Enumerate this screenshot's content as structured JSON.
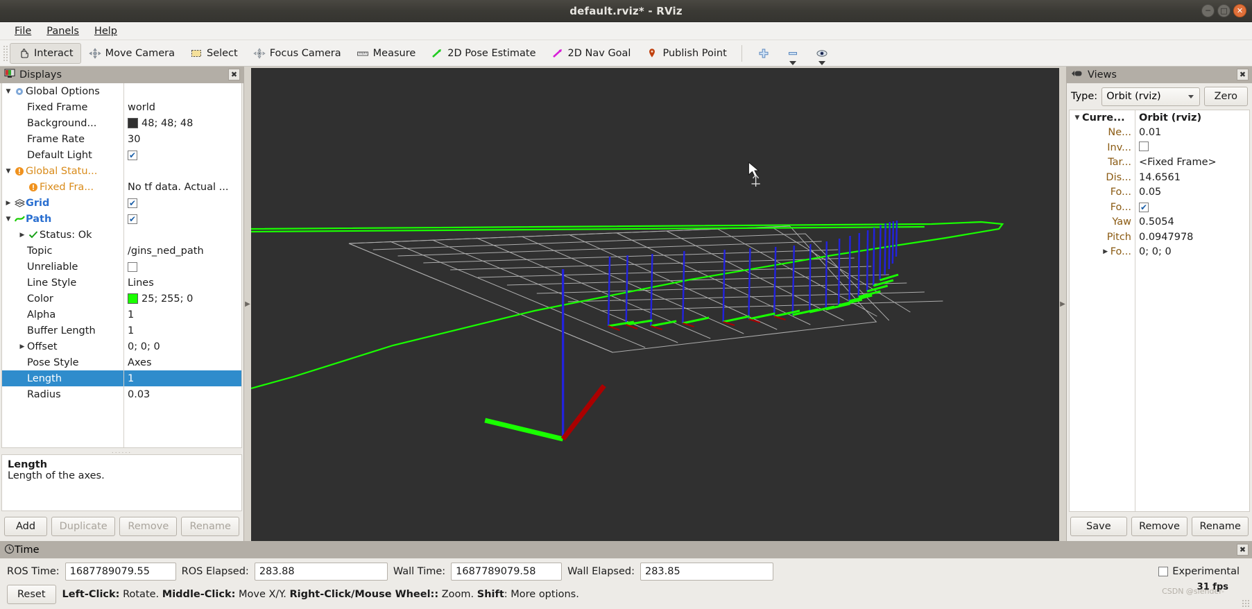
{
  "window": {
    "title": "default.rviz* - RViz",
    "controls": [
      "minimize",
      "maximize",
      "close"
    ]
  },
  "menubar": {
    "items": [
      {
        "label": "File",
        "icon": "menu-file"
      },
      {
        "label": "Panels",
        "icon": "menu-panels"
      },
      {
        "label": "Help",
        "icon": "menu-help"
      }
    ]
  },
  "toolbar": {
    "items": [
      {
        "label": "Interact",
        "icon": "hand-cursor-icon",
        "active": true
      },
      {
        "label": "Move Camera",
        "icon": "move-camera-icon",
        "active": false
      },
      {
        "label": "Select",
        "icon": "select-rect-icon",
        "active": false
      },
      {
        "label": "Focus Camera",
        "icon": "focus-camera-icon",
        "active": false
      },
      {
        "label": "Measure",
        "icon": "ruler-icon",
        "active": false
      },
      {
        "label": "2D Pose Estimate",
        "icon": "green-arrow-icon",
        "active": false
      },
      {
        "label": "2D Nav Goal",
        "icon": "magenta-arrow-icon",
        "active": false
      },
      {
        "label": "Publish Point",
        "icon": "map-pin-icon",
        "active": false
      }
    ],
    "extra_icons": [
      {
        "icon": "plus-icon",
        "label": ""
      },
      {
        "icon": "minus-icon",
        "label": ""
      },
      {
        "icon": "eye-icon",
        "label": ""
      }
    ]
  },
  "displays": {
    "title": "Displays",
    "title_icon": "displays-monitor-icon",
    "close_icon": "close-icon",
    "rows": [
      {
        "indent": 0,
        "twisty": "down",
        "icon": "gear-icon",
        "label": "Global Options",
        "label_class": "",
        "value_type": "none",
        "value": ""
      },
      {
        "indent": 1,
        "twisty": "",
        "icon": "",
        "label": "Fixed Frame",
        "label_class": "",
        "value_type": "text",
        "value": "world"
      },
      {
        "indent": 1,
        "twisty": "",
        "icon": "",
        "label": "Background...",
        "label_class": "",
        "value_type": "color",
        "value": "48; 48; 48",
        "color": "#303030"
      },
      {
        "indent": 1,
        "twisty": "",
        "icon": "",
        "label": "Frame Rate",
        "label_class": "",
        "value_type": "text",
        "value": "30"
      },
      {
        "indent": 1,
        "twisty": "",
        "icon": "",
        "label": "Default Light",
        "label_class": "",
        "value_type": "check",
        "value": "checked"
      },
      {
        "indent": 0,
        "twisty": "down",
        "icon": "warning-icon",
        "label": "Global Statu...",
        "label_class": "label-orange",
        "value_type": "none",
        "value": ""
      },
      {
        "indent": 1,
        "twisty": "",
        "icon": "warning-icon",
        "label": "Fixed Fra...",
        "label_class": "label-orange",
        "value_type": "text",
        "value": "No tf data.  Actual ..."
      },
      {
        "indent": 0,
        "twisty": "right",
        "icon": "grid-icon",
        "label": "Grid",
        "label_class": "label-blue",
        "value_type": "check",
        "value": "checked"
      },
      {
        "indent": 0,
        "twisty": "down",
        "icon": "path-icon",
        "label": "Path",
        "label_class": "label-blue",
        "value_type": "check",
        "value": "checked"
      },
      {
        "indent": 1,
        "twisty": "right",
        "icon": "status-ok-icon",
        "label": "Status: Ok",
        "label_class": "",
        "value_type": "none",
        "value": ""
      },
      {
        "indent": 1,
        "twisty": "",
        "icon": "",
        "label": "Topic",
        "label_class": "",
        "value_type": "text",
        "value": "/gins_ned_path"
      },
      {
        "indent": 1,
        "twisty": "",
        "icon": "",
        "label": "Unreliable",
        "label_class": "",
        "value_type": "check",
        "value": "unchecked"
      },
      {
        "indent": 1,
        "twisty": "",
        "icon": "",
        "label": "Line Style",
        "label_class": "",
        "value_type": "text",
        "value": "Lines"
      },
      {
        "indent": 1,
        "twisty": "",
        "icon": "",
        "label": "Color",
        "label_class": "",
        "value_type": "color",
        "value": "25; 255; 0",
        "color": "#19ff00"
      },
      {
        "indent": 1,
        "twisty": "",
        "icon": "",
        "label": "Alpha",
        "label_class": "",
        "value_type": "text",
        "value": "1"
      },
      {
        "indent": 1,
        "twisty": "",
        "icon": "",
        "label": "Buffer Length",
        "label_class": "",
        "value_type": "text",
        "value": "1"
      },
      {
        "indent": 1,
        "twisty": "right",
        "icon": "",
        "label": "Offset",
        "label_class": "",
        "value_type": "text",
        "value": "0; 0; 0"
      },
      {
        "indent": 1,
        "twisty": "",
        "icon": "",
        "label": "Pose Style",
        "label_class": "",
        "value_type": "text",
        "value": "Axes"
      },
      {
        "indent": 1,
        "twisty": "",
        "icon": "",
        "label": "Length",
        "label_class": "",
        "value_type": "text",
        "value": "1",
        "selected": true
      },
      {
        "indent": 1,
        "twisty": "",
        "icon": "",
        "label": "Radius",
        "label_class": "",
        "value_type": "text",
        "value": "0.03"
      }
    ],
    "description": {
      "title": "Length",
      "text": "Length of the axes."
    },
    "buttons": [
      {
        "label": "Add",
        "enabled": true
      },
      {
        "label": "Duplicate",
        "enabled": false
      },
      {
        "label": "Remove",
        "enabled": false
      },
      {
        "label": "Rename",
        "enabled": false
      }
    ]
  },
  "views": {
    "title": "Views",
    "title_icon": "views-camera-icon",
    "close_icon": "close-icon",
    "type_label": "Type:",
    "type_value": "Orbit (rviz)",
    "zero_button": "Zero",
    "rows": [
      {
        "label": "Curre...",
        "value": "Orbit (rviz)",
        "head": true,
        "twisty": "down",
        "value_type": "text"
      },
      {
        "label": "Ne...",
        "value": "0.01",
        "head": false,
        "twisty": "",
        "value_type": "text"
      },
      {
        "label": "Inv...",
        "value": "unchecked",
        "head": false,
        "twisty": "",
        "value_type": "check"
      },
      {
        "label": "Tar...",
        "value": "<Fixed Frame>",
        "head": false,
        "twisty": "",
        "value_type": "text"
      },
      {
        "label": "Dis...",
        "value": "14.6561",
        "head": false,
        "twisty": "",
        "value_type": "text"
      },
      {
        "label": "Fo...",
        "value": "0.05",
        "head": false,
        "twisty": "",
        "value_type": "text"
      },
      {
        "label": "Fo...",
        "value": "checked",
        "head": false,
        "twisty": "",
        "value_type": "check"
      },
      {
        "label": "Yaw",
        "value": "0.5054",
        "head": false,
        "twisty": "",
        "value_type": "text"
      },
      {
        "label": "Pitch",
        "value": "0.0947978",
        "head": false,
        "twisty": "",
        "value_type": "text"
      },
      {
        "label": "Fo...",
        "value": "0; 0; 0",
        "head": false,
        "twisty": "right",
        "value_type": "text"
      }
    ],
    "buttons": [
      {
        "label": "Save"
      },
      {
        "label": "Remove"
      },
      {
        "label": "Rename"
      }
    ]
  },
  "time": {
    "title": "Time",
    "title_icon": "clock-icon",
    "close_icon": "close-icon",
    "fields": [
      {
        "label": "ROS Time:",
        "value": "1687789079.55",
        "width": "time"
      },
      {
        "label": "ROS Elapsed:",
        "value": "283.88",
        "width": "elapsed"
      },
      {
        "label": "Wall Time:",
        "value": "1687789079.58",
        "width": "time"
      },
      {
        "label": "Wall Elapsed:",
        "value": "283.85",
        "width": "elapsed"
      }
    ],
    "experimental_label": "Experimental",
    "experimental_checked": false,
    "reset_button": "Reset",
    "hint_parts": [
      {
        "text": "Left-Click:",
        "bold": true
      },
      {
        "text": " Rotate. ",
        "bold": false
      },
      {
        "text": "Middle-Click:",
        "bold": true
      },
      {
        "text": " Move X/Y. ",
        "bold": false
      },
      {
        "text": "Right-Click/Mouse Wheel::",
        "bold": true
      },
      {
        "text": " Zoom. ",
        "bold": false
      },
      {
        "text": "Shift",
        "bold": true
      },
      {
        "text": ": More options.",
        "bold": false
      }
    ],
    "fps": "31 fps",
    "watermark": "CSDN @slender-"
  },
  "viewport": {
    "background_color": "#303030",
    "grid_color": "#b4b4b4",
    "path_color": "#19ff00",
    "axis_x_color": "#aa0000",
    "axis_y_color": "#19ff00",
    "axis_z_color": "#2222dd",
    "cursor": "arrow-cursor"
  }
}
